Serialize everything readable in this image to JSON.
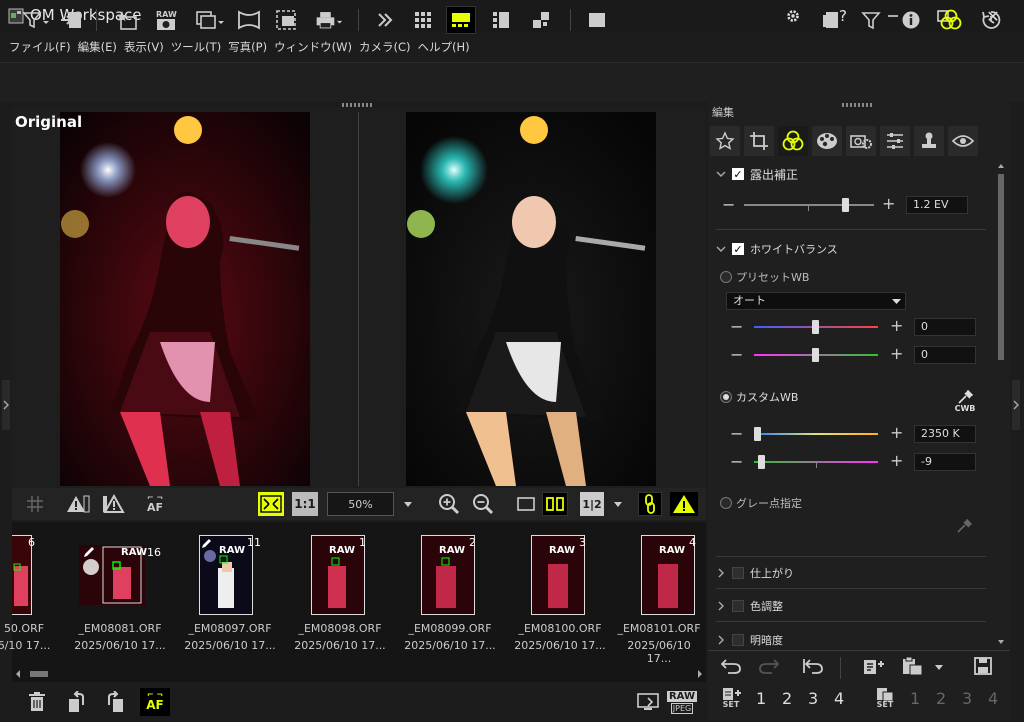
{
  "window": {
    "title": "OM Workspace",
    "settings_icon": "gear-icon",
    "help_label": "?",
    "minimize_icon": "minimize-icon",
    "maximize_icon": "maximize-icon",
    "close_label": "✕"
  },
  "menu": [
    "ファイル(F)",
    "編集(E)",
    "表示(V)",
    "ツール(T)",
    "写真(P)",
    "ウィンドウ(W)",
    "カメラ(C)",
    "ヘルプ(H)"
  ],
  "viewer": {
    "original_label": "Original",
    "zoom_value": "50%",
    "ratio_label": "1:1",
    "af_label": "AF",
    "compare_label": "1|2"
  },
  "filmstrip": [
    {
      "number": "6",
      "name": "50.ORF",
      "date": "6/10 17..."
    },
    {
      "number": "16",
      "name": "_EM08081.ORF",
      "date": "2025/06/10 17...",
      "raw": "RAW"
    },
    {
      "number": "11",
      "name": "_EM08097.ORF",
      "date": "2025/06/10 17...",
      "raw": "RAW"
    },
    {
      "number": "1",
      "name": "_EM08098.ORF",
      "date": "2025/06/10 17...",
      "raw": "RAW"
    },
    {
      "number": "2",
      "name": "_EM08099.ORF",
      "date": "2025/06/10 17...",
      "raw": "RAW"
    },
    {
      "number": "3",
      "name": "_EM08100.ORF",
      "date": "2025/06/10 17...",
      "raw": "RAW"
    },
    {
      "number": "4",
      "name": "_EM08101.ORF",
      "date": "2025/06/10 17...",
      "raw": "RAW"
    }
  ],
  "bottombar": {
    "af_label": "AF",
    "raw_label": "RAW",
    "jpeg_label": "JPEG"
  },
  "panel": {
    "header": "編集",
    "exposure": {
      "label": "露出補正",
      "value": "1.2 EV",
      "level": 0.8
    },
    "white_balance": {
      "label": "ホワイトバランス",
      "preset_label": "プリセットWB",
      "preset_value": "オート",
      "preset_slider1_value": "0",
      "preset_slider2_value": "0",
      "custom_label": "カスタムWB",
      "cwb_label": "CWB",
      "kelvin_value": "2350 K",
      "tint_value": "-9",
      "gray_label": "グレー点指定"
    },
    "collapsed_sections": [
      "仕上がり",
      "色調整",
      "明暗度"
    ],
    "set_label": "SET",
    "set_numbers": [
      "1",
      "2",
      "3",
      "4"
    ]
  }
}
